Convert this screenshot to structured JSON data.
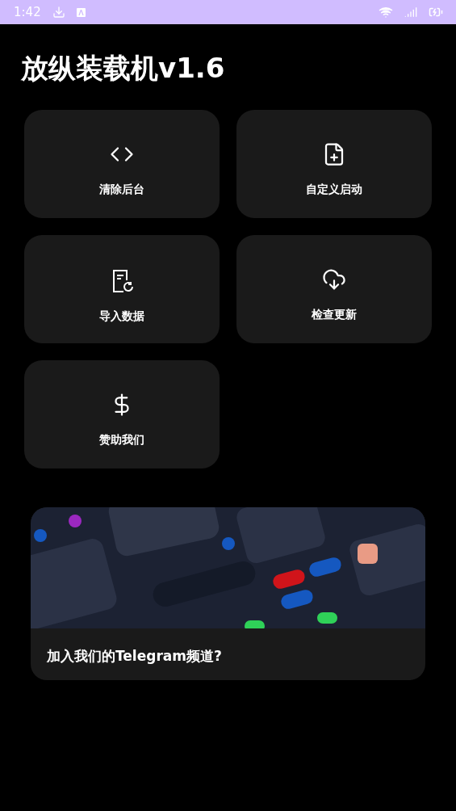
{
  "status_bar": {
    "time": "1:42"
  },
  "title": "放纵装载机v1.6",
  "actions": [
    {
      "label": "清除后台"
    },
    {
      "label": "自定义启动"
    },
    {
      "label": "导入数据"
    },
    {
      "label": "检查更新"
    },
    {
      "label": "赞助我们"
    }
  ],
  "banner": {
    "caption": "加入我们的Telegram频道?"
  }
}
